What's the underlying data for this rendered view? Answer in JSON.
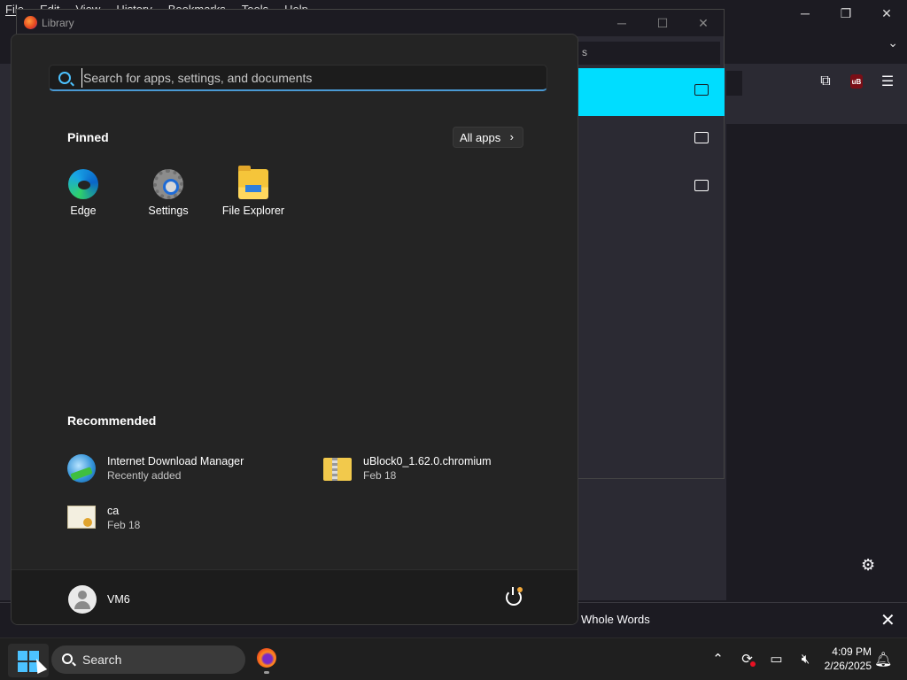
{
  "firefox": {
    "menubar": [
      "File",
      "Edit",
      "View",
      "History",
      "Bookmarks",
      "Tools",
      "Help"
    ],
    "findbar": {
      "whole_words_label": "Whole Words"
    }
  },
  "library": {
    "title": "Library",
    "search_partial": "s"
  },
  "start_menu": {
    "search_placeholder": "Search for apps, settings, and documents",
    "pinned_heading": "Pinned",
    "all_apps_label": "All apps",
    "pinned": [
      {
        "label": "Edge",
        "icon": "edge-icon"
      },
      {
        "label": "Settings",
        "icon": "settings-gear-icon"
      },
      {
        "label": "File Explorer",
        "icon": "file-explorer-icon"
      }
    ],
    "recommended_heading": "Recommended",
    "recommended": [
      {
        "name": "Internet Download Manager",
        "sub": "Recently added",
        "icon": "idm-icon"
      },
      {
        "name": "uBlock0_1.62.0.chromium",
        "sub": "Feb 18",
        "icon": "zip-folder-icon"
      },
      {
        "name": "ca",
        "sub": "Feb 18",
        "icon": "certificate-icon"
      }
    ],
    "user": {
      "name": "VM6"
    }
  },
  "taskbar": {
    "search_label": "Search",
    "time": "4:09 PM",
    "date": "2/26/2025"
  },
  "colors": {
    "accent": "#4cc2ff",
    "library_selected_row": "#00ddff",
    "start_bg": "#242424",
    "taskbar_bg": "#1f1f1f"
  }
}
